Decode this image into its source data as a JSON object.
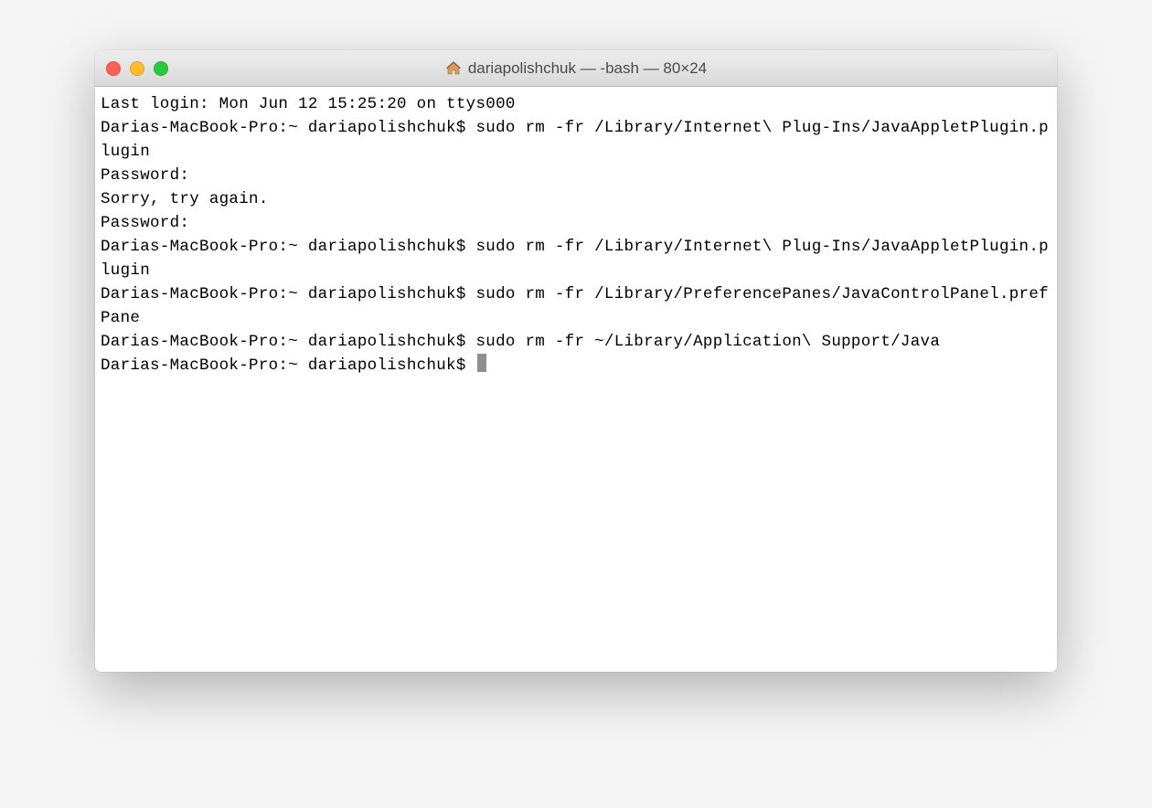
{
  "window": {
    "title": "dariapolishchuk — -bash — 80×24"
  },
  "terminal": {
    "lines": [
      "Last login: Mon Jun 12 15:25:20 on ttys000",
      "Darias-MacBook-Pro:~ dariapolishchuk$ sudo rm -fr /Library/Internet\\ Plug-Ins/JavaAppletPlugin.plugin",
      "Password:",
      "Sorry, try again.",
      "Password:",
      "Darias-MacBook-Pro:~ dariapolishchuk$ sudo rm -fr /Library/Internet\\ Plug-Ins/JavaAppletPlugin.plugin",
      "Darias-MacBook-Pro:~ dariapolishchuk$ sudo rm -fr /Library/PreferencePanes/JavaControlPanel.prefPane",
      "Darias-MacBook-Pro:~ dariapolishchuk$ sudo rm -fr ~/Library/Application\\ Support/Java",
      "Darias-MacBook-Pro:~ dariapolishchuk$ "
    ]
  }
}
